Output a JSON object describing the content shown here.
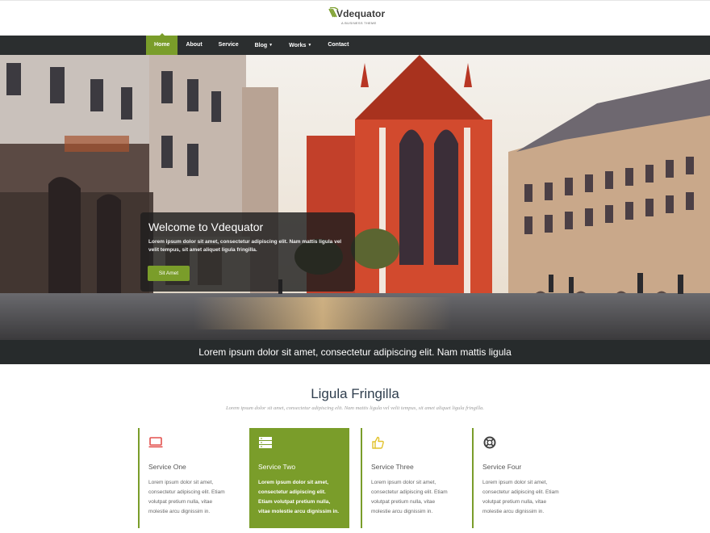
{
  "brand": {
    "name": "Vdequator",
    "tagline": "A BUSINESS THEME",
    "accent_color": "#7a9d2a"
  },
  "nav": {
    "items": [
      {
        "label": "Home",
        "active": true,
        "has_dropdown": false
      },
      {
        "label": "About",
        "active": false,
        "has_dropdown": false
      },
      {
        "label": "Service",
        "active": false,
        "has_dropdown": false
      },
      {
        "label": "Blog",
        "active": false,
        "has_dropdown": true
      },
      {
        "label": "Works",
        "active": false,
        "has_dropdown": true
      },
      {
        "label": "Contact",
        "active": false,
        "has_dropdown": false
      }
    ]
  },
  "hero": {
    "title": "Welcome to Vdequator",
    "text": "Lorem ipsum dolor sit amet, consectetur adipiscing elit. Nam mattis ligula vel velit tempus, sit amet aliquet ligula fringilla.",
    "button_label": "Sit Amet"
  },
  "caption": "Lorem ipsum dolor sit amet, consectetur adipiscing elit. Nam mattis ligula",
  "section": {
    "title": "Ligula Fringilla",
    "subtitle": "Lorem ipsum dolor sit amet, consectetur adipiscing elit. Nam mattis ligula vel velit tempus, sit amet aliquet ligula fringilla."
  },
  "services": [
    {
      "title": "Service One",
      "icon": "monitor-icon",
      "text": "Lorem ipsum dolor sit amet, consectetur adipiscing elit. Etiam volutpat pretium nulla, vitae molestie arcu dignissim in."
    },
    {
      "title": "Service Two",
      "icon": "server-icon",
      "text": "Lorem ipsum dolor sit amet, consectetur adipiscing elit. Etiam volutpat pretium nulla, vitae molestie arcu dignissim in."
    },
    {
      "title": "Service Three",
      "icon": "thumbs-up-icon",
      "text": "Lorem ipsum dolor sit amet, consectetur adipiscing elit. Etiam volutpat pretium nulla, vitae molestie arcu dignissim in."
    },
    {
      "title": "Service Four",
      "icon": "life-ring-icon",
      "text": "Lorem ipsum dolor sit amet, consectetur adipiscing elit. Etiam volutpat pretium nulla, vitae molestie arcu dignissim in."
    }
  ]
}
